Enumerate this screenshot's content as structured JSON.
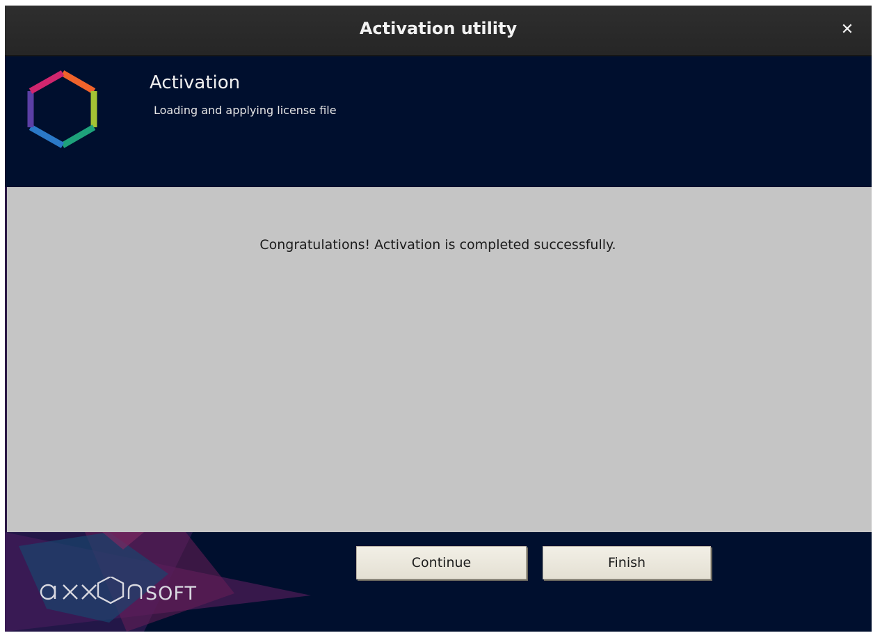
{
  "window": {
    "title": "Activation utility",
    "close_glyph": "✕"
  },
  "header": {
    "title": "Activation",
    "subtitle": "Loading and applying license file",
    "logo_icon": "hexagon-logo-icon"
  },
  "content": {
    "message": "Congratulations! Activation is completed successfully."
  },
  "footer": {
    "brand": "axxonsoft",
    "continue_label": "Continue",
    "finish_label": "Finish"
  },
  "colors": {
    "titlebar": "#2b2b2b",
    "header_bg": "#000f2e",
    "content_bg": "#c5c5c5",
    "button_bg": "#ebe8dd"
  }
}
